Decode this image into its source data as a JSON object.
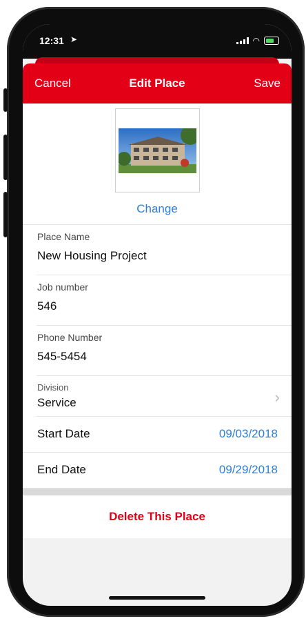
{
  "status_bar": {
    "time": "12:31"
  },
  "navbar": {
    "cancel_label": "Cancel",
    "title": "Edit Place",
    "save_label": "Save"
  },
  "photo": {
    "change_label": "Change"
  },
  "fields": [
    {
      "label": "Place Name",
      "value": "New Housing Project"
    },
    {
      "label": "Job number",
      "value": "546"
    },
    {
      "label": "Phone Number",
      "value": "545-5454"
    }
  ],
  "division": {
    "label": "Division",
    "value": "Service"
  },
  "dates": {
    "start_label": "Start Date",
    "start_value": "09/03/2018",
    "end_label": "End Date",
    "end_value": "09/29/2018"
  },
  "delete_label": "Delete This Place",
  "colors": {
    "brand_red": "#e30016",
    "link_blue": "#2b7fd8"
  }
}
